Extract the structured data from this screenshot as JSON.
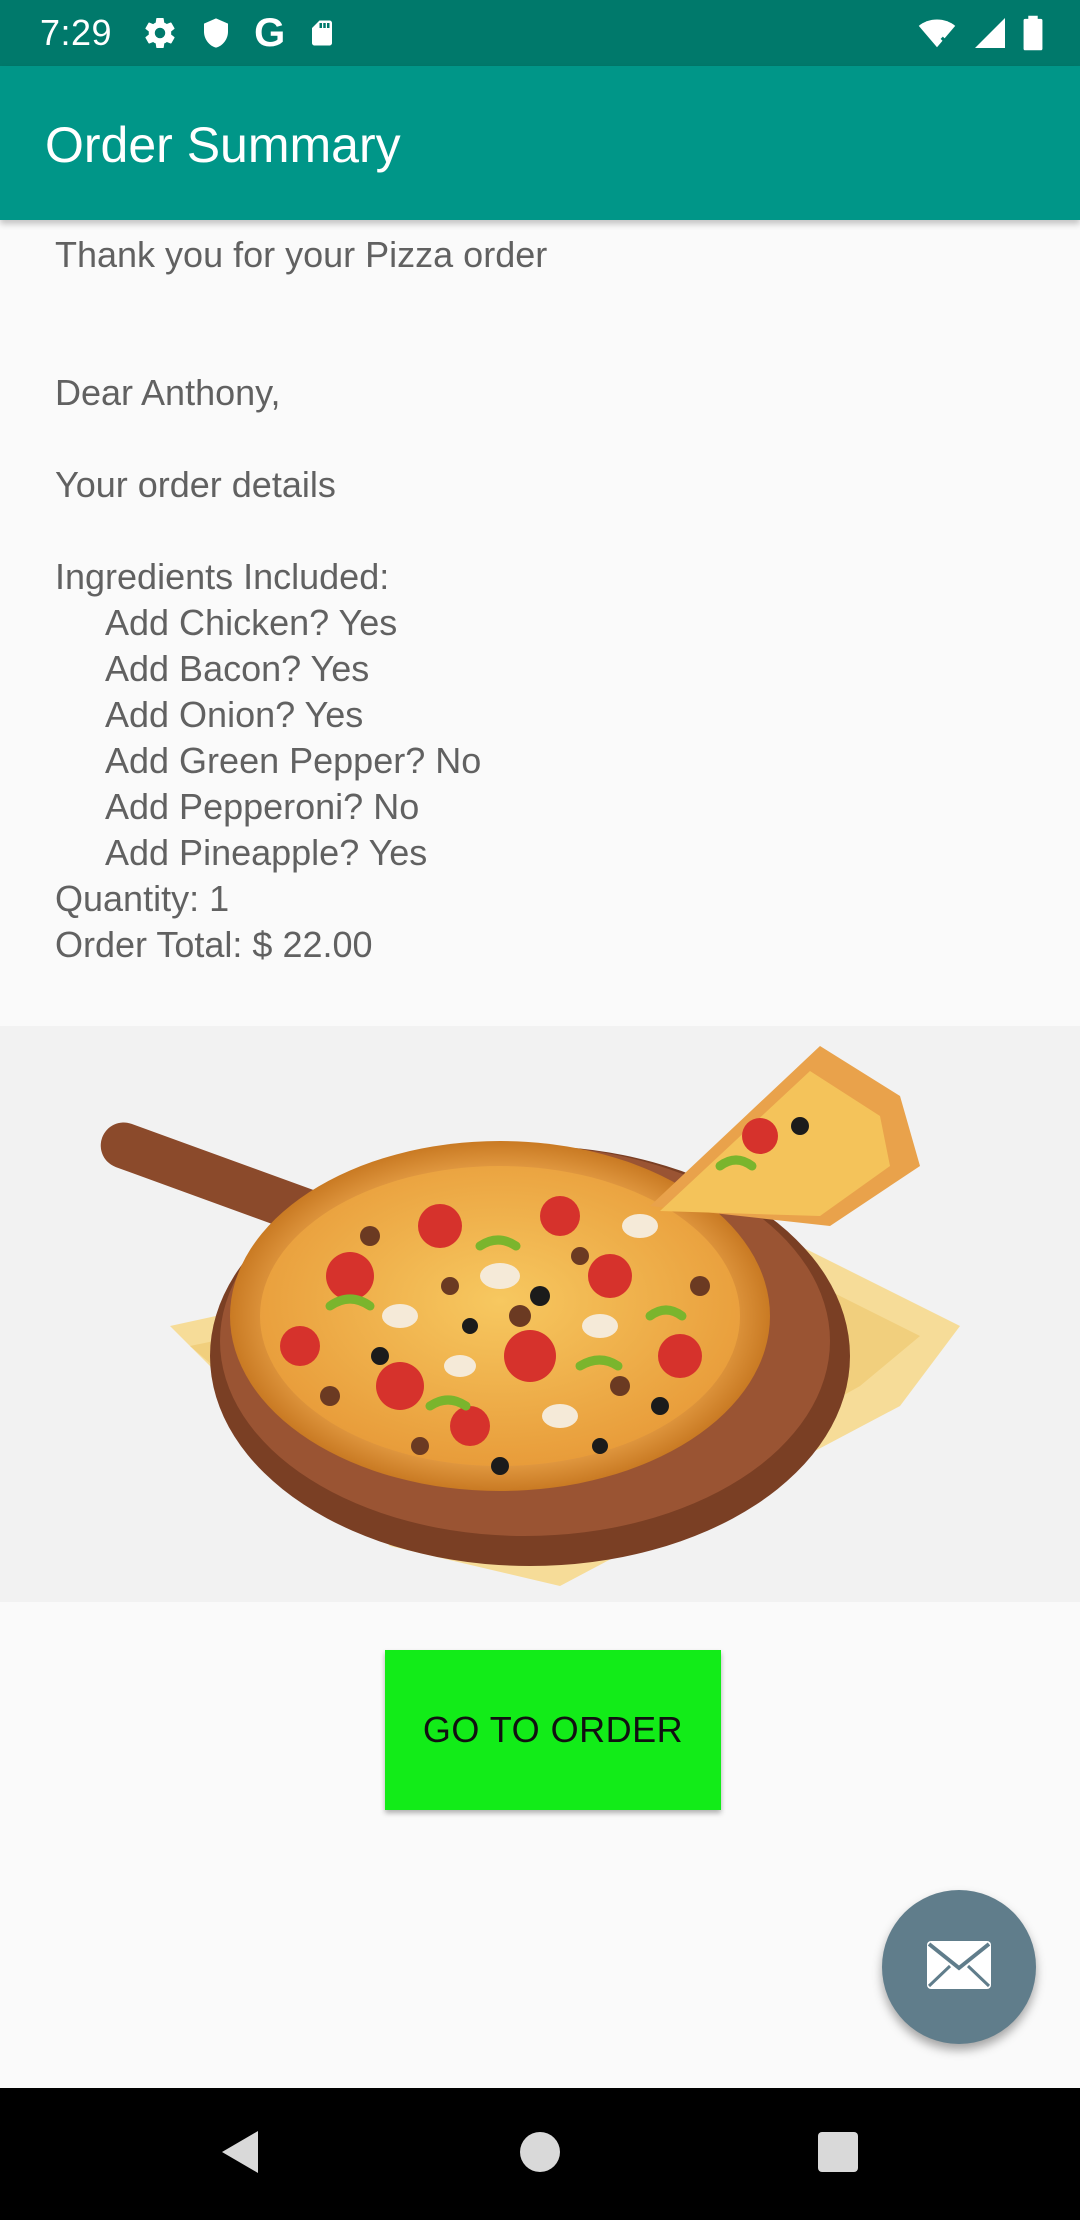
{
  "status_bar": {
    "time": "7:29",
    "left_icons": [
      "gear-icon",
      "shield-icon",
      "google-g-icon",
      "sd-card-icon"
    ],
    "google_glyph": "G",
    "right_icons": [
      "wifi-icon",
      "signal-icon",
      "battery-icon"
    ]
  },
  "app_bar": {
    "title": "Order Summary"
  },
  "summary": {
    "thanks": "Thank you for your Pizza order",
    "greeting": "Dear Anthony,",
    "details_heading": "Your order details",
    "ingredients_heading": "Ingredients Included:",
    "ingredients": [
      "Add Chicken? Yes",
      "Add Bacon? Yes",
      "Add Onion? Yes",
      "Add Green Pepper? No",
      "Add Pepperoni? No",
      "Add Pineapple? Yes"
    ],
    "quantity": "Quantity: 1",
    "total": "Order Total: $ 22.00"
  },
  "image": {
    "subject": "pizza-on-wooden-board"
  },
  "actions": {
    "go_to_order": "GO TO ORDER"
  },
  "fab": {
    "icon": "mail-icon"
  },
  "nav": {
    "icons": [
      "back-icon",
      "home-icon",
      "recents-icon"
    ]
  },
  "colors": {
    "status_bar": "#00796b",
    "app_bar": "#009688",
    "button": "#12ec18",
    "fab": "#607d8b",
    "text": "#616161"
  }
}
